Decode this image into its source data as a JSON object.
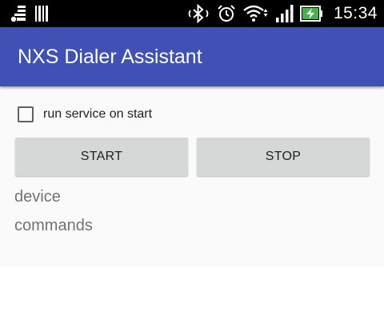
{
  "status_bar": {
    "time": "15:34",
    "icons_left": [
      "notification-icon",
      "barcode-icon"
    ],
    "icons_right": [
      "bluetooth-icon",
      "alarm-icon",
      "wifi-icon",
      "signal-icon",
      "battery-charging-icon"
    ]
  },
  "app_bar": {
    "title": "NXS Dialer Assistant",
    "color": "#3F51B5"
  },
  "settings": {
    "run_on_start_label": "run service on start",
    "run_on_start_checked": false
  },
  "controls": {
    "start_label": "START",
    "stop_label": "STOP"
  },
  "info": {
    "device_label": "device",
    "commands_label": "commands"
  }
}
